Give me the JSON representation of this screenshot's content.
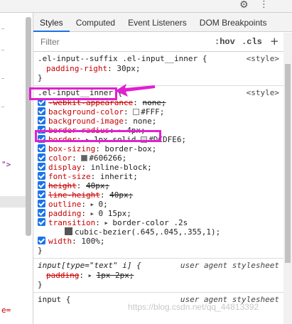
{
  "left_pane": {
    "arrow_text": "\">",
    "eq_text": "e="
  },
  "toolbar": {
    "gear_icon": "gear-icon",
    "menu_icon": "kebab-menu-icon"
  },
  "tabs": [
    {
      "label": "Styles",
      "active": true
    },
    {
      "label": "Computed",
      "active": false
    },
    {
      "label": "Event Listeners",
      "active": false
    },
    {
      "label": "DOM Breakpoints",
      "active": false
    }
  ],
  "filter": {
    "placeholder": "Filter",
    "hov_label": ":hov",
    "cls_label": ".cls",
    "add_label": "+"
  },
  "rules": {
    "r1": {
      "selector": ".el-input--suffix .el-input__inner {",
      "origin": "<style>",
      "decl1": {
        "name": "padding-right",
        "value": "30px;"
      },
      "close": "}"
    },
    "r2": {
      "selector": ".el-input__inner {",
      "origin": "<style>",
      "decls": [
        {
          "name": "-webkit-appearance",
          "value": "none;"
        },
        {
          "name": "background-color",
          "value": "#FFF;"
        },
        {
          "name": "background-image",
          "value": "none;"
        },
        {
          "name": "border-radius",
          "value": "4px;"
        },
        {
          "name": "border",
          "value": "1px solid",
          "value2": "#DCDFE6;"
        },
        {
          "name": "box-sizing",
          "value": "border-box;"
        },
        {
          "name": "color",
          "value": "#606266;"
        },
        {
          "name": "display",
          "value": "inline-block;"
        },
        {
          "name": "font-size",
          "value": "inherit;"
        },
        {
          "name": "height",
          "value": "40px;"
        },
        {
          "name": "line-height",
          "value": "40px;"
        },
        {
          "name": "outline",
          "value": "0;"
        },
        {
          "name": "padding",
          "value": "0 15px;"
        },
        {
          "name": "transition",
          "value": "border-color .2s",
          "value2": "cubic-bezier(.645,.045,.355,1);"
        },
        {
          "name": "width",
          "value": "100%;"
        }
      ],
      "close": "}"
    },
    "r3": {
      "selector": "input[type=\"text\" i] {",
      "origin": "user agent stylesheet",
      "decl1": {
        "name": "padding",
        "value": "1px 2px;"
      },
      "close": "}"
    },
    "r4": {
      "selector": "input {",
      "origin": "user agent stylesheet"
    }
  },
  "colors": {
    "accent": "#1a73e8",
    "annotation": "#e020d0",
    "prop_name": "#c80000",
    "swatch_bg": "#FFFFFF",
    "swatch_border": "#DCDFE6",
    "swatch_color": "#606266"
  },
  "watermark": "https://blog.csdn.net/qq_44813392"
}
